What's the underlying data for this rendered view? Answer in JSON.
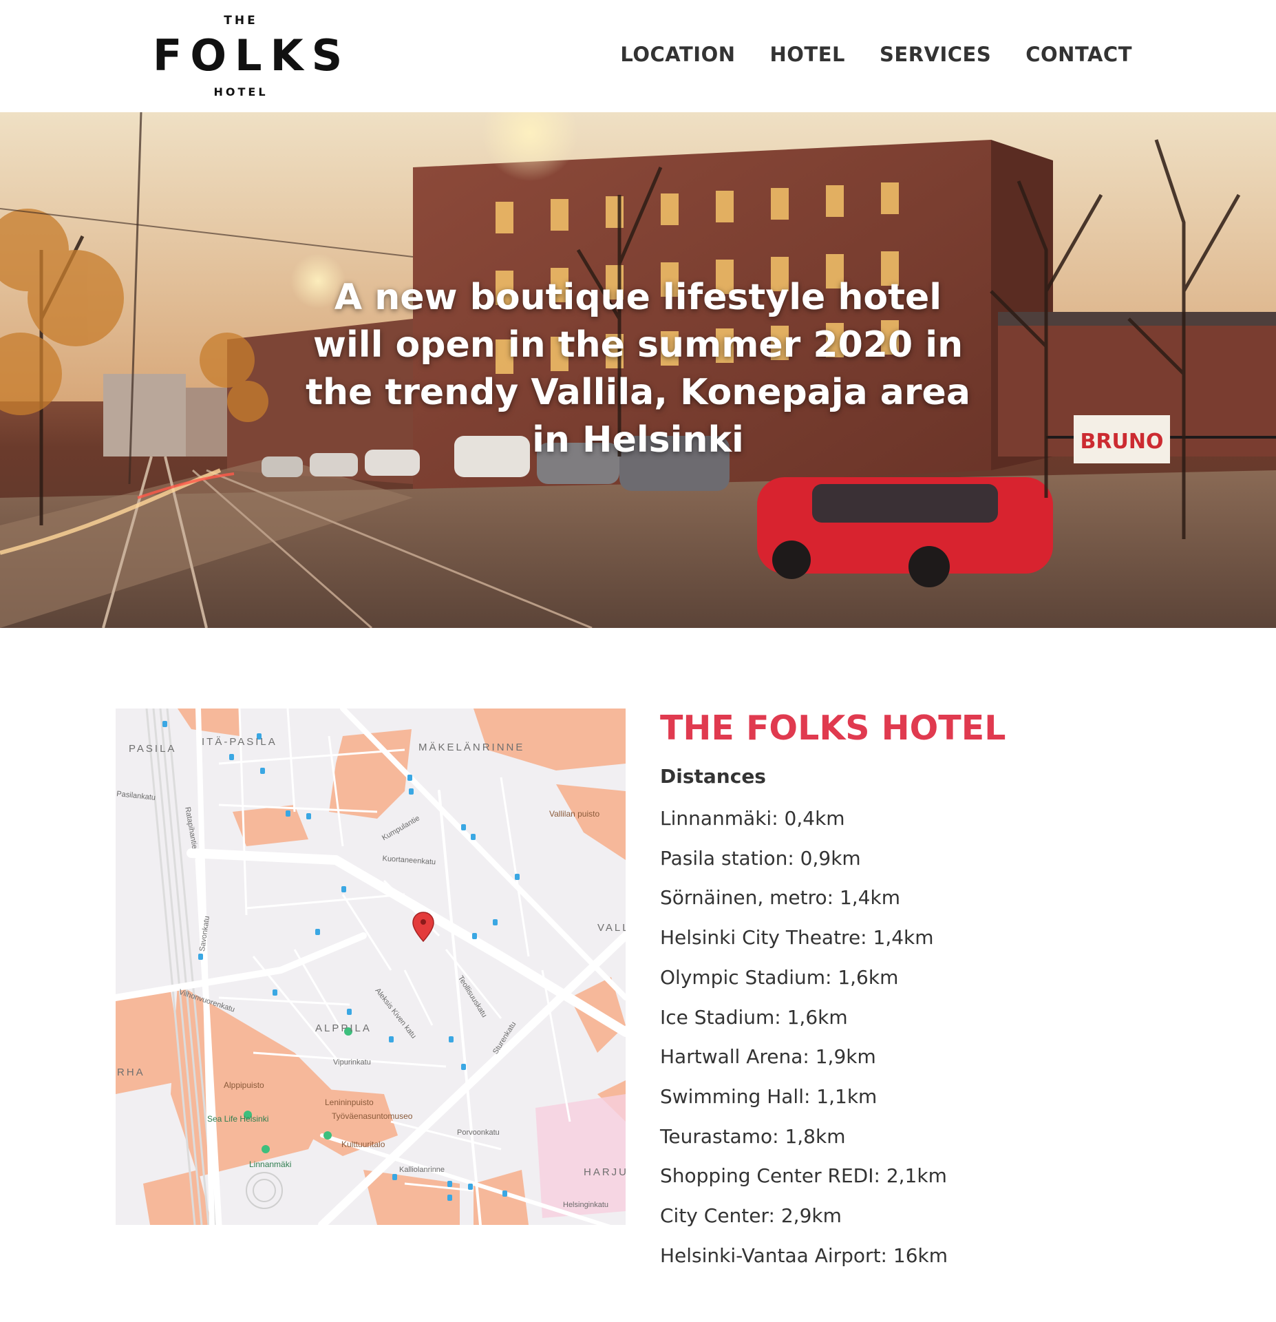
{
  "header": {
    "logo": {
      "top": "THE",
      "main": "FOLKS",
      "bottom": "HOTEL"
    },
    "nav": [
      {
        "label": "LOCATION"
      },
      {
        "label": "HOTEL"
      },
      {
        "label": "SERVICES"
      },
      {
        "label": "CONTACT"
      }
    ]
  },
  "hero": {
    "headline": "A new boutique lifestyle hotel will open in the summer 2020 in the trendy Vallila, Konepaja area in Helsinki",
    "image_description_icon": "street-photo",
    "sign_text": "BRUNO"
  },
  "map": {
    "districts": [
      "PASILA",
      "ITÄ-PASILA",
      "MÄKELÄNRINNE",
      "ALPPILA",
      "RHA",
      "HARJU",
      "VALL"
    ],
    "places": [
      "Vallilan puisto",
      "Alppipuisto",
      "Lenininpuisto",
      "Työväenasuntomuseo",
      "Kulttuuritalo",
      "Sea Life Helsinki",
      "Linnanmäki"
    ],
    "streets": [
      "Teollisuuskatu",
      "Sturenkatu",
      "Savonkatu",
      "Ratapihantie",
      "Aleksis Kiven katu",
      "Vilhonvuorenkatu",
      "Vipurinkatu",
      "Porvoonkatu",
      "Kuortaneenkatu",
      "Kumpulantie",
      "Helsinginkatu",
      "Kalliolanrinne",
      "Pasilankatu"
    ],
    "marker_icon": "map-pin-icon"
  },
  "info": {
    "title": "THE FOLKS HOTEL",
    "subtitle": "Distances",
    "distances": [
      "Linnanmäki: 0,4km",
      "Pasila station: 0,9km",
      "Sörnäinen, metro: 1,4km",
      "Helsinki City Theatre: 1,4km",
      "Olympic Stadium: 1,6km",
      "Ice Stadium: 1,6km",
      "Hartwall Arena: 1,9km",
      "Swimming Hall: 1,1km",
      "Teurastamo: 1,8km",
      "Shopping Center REDI: 2,1km",
      "City Center: 2,9km",
      "Helsinki-Vantaa Airport: 16km"
    ]
  },
  "colors": {
    "accent": "#e03a4f",
    "text": "#333333",
    "map_background": "#f1eff2",
    "map_park": "#f6b89a",
    "map_road": "#ffffff"
  }
}
